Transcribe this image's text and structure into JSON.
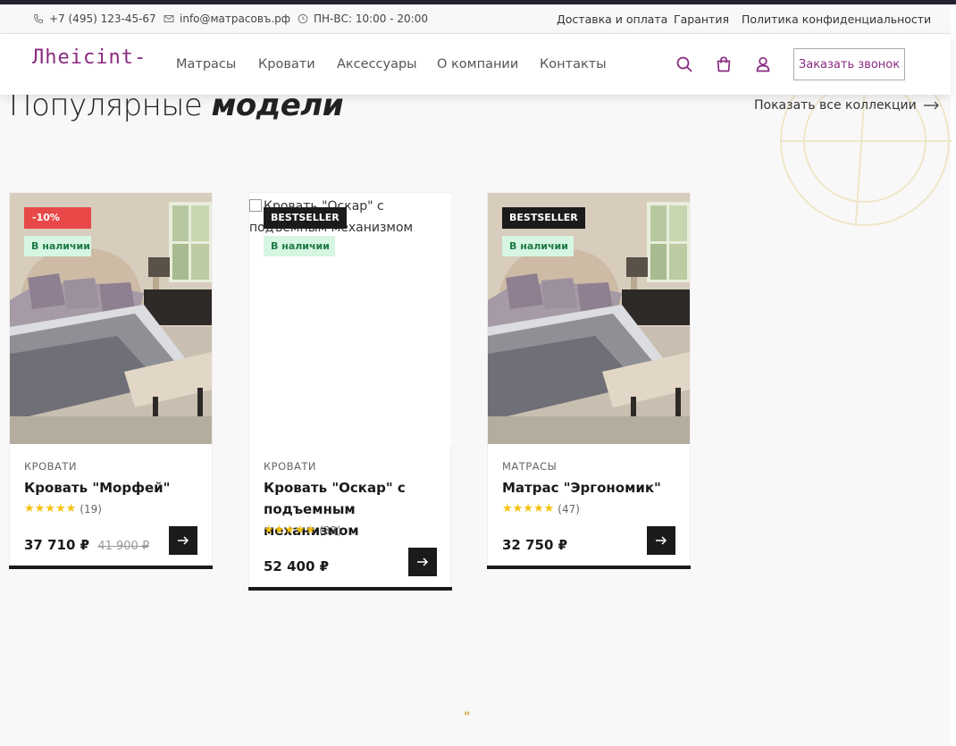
{
  "topbar": {
    "phone": "+7 (495) 123-45-67",
    "email": "info@матрасовъ.рф",
    "hours": "ПН-ВС: 10:00 - 20:00",
    "links": [
      "Доставка и оплата",
      "Гарантия",
      "Политика конфиденциальности"
    ]
  },
  "header": {
    "logo_text": "Лhеicint-",
    "nav": [
      "Матрасы",
      "Кровати",
      "Аксессуары",
      "О компании",
      "Контакты"
    ],
    "icons": [
      "search-icon",
      "cart-icon",
      "user-icon"
    ],
    "call_button": "Заказать звонок",
    "accent_color": "#8a2a80"
  },
  "section": {
    "title_light": "Популярные ",
    "title_bold": "модели",
    "show_all": "Показать все коллекции"
  },
  "products": [
    {
      "badge": "-10%",
      "stock": "В наличии",
      "category": "КРОВАТИ",
      "name": "Кровать \"Морфей\"",
      "stars": "★★★★★",
      "reviews": "(19)",
      "price": "37 710 ₽",
      "old_price": "41 900 ₽"
    },
    {
      "badge": "BESTSELLER",
      "stock": "В наличии",
      "image_alt": "Кровать \"Оскар\" с подъемным механизмом",
      "category": "КРОВАТИ",
      "name": "Кровать \"Оскар\" с подъемным механизмом",
      "stars": "★★★★★",
      "reviews": "(33)",
      "price": "52 400 ₽"
    },
    {
      "badge": "BESTSELLER",
      "stock": "В наличии",
      "category": "МАТРАСЫ",
      "name": "Матрас \"Эргономик\"",
      "stars": "★★★★★",
      "reviews": "(47)",
      "price": "32 750 ₽"
    }
  ],
  "quote_mark": "\""
}
